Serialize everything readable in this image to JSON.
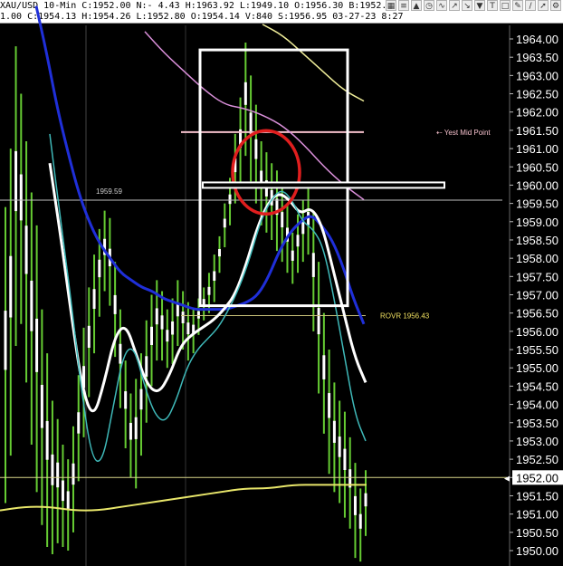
{
  "header": {
    "title_line": "XAU/USD 10-Min C:1952.00 N:- 4.43 H:1963.92 L:1949.10 O:1956.30 B:1952.",
    "info_line": "1.00 C:1954.13 H:1954.26 L:1952.80 O:1954.14 V:840 S:1956.95 03-27-23 8:27"
  },
  "toolbar": {
    "icons": [
      "grid-icon",
      "stack-icon",
      "pyramid-icon",
      "clock-icon",
      "wave-icon",
      "arrow-icon",
      "arrow-icon",
      "down-icon",
      "text-icon",
      "box-icon",
      "pencil-icon",
      "line-icon",
      "cursor-icon",
      "gear-icon"
    ]
  },
  "colors": {
    "background": "#000000",
    "price_labels": "#ffffff",
    "candles": "#ffffff",
    "candle_wick": "#66cc33",
    "ma_blue": "#1f2fd8",
    "ma_white": "#ffffff",
    "ma_teal": "#3fb9b9",
    "ma_pink": "#d98fd9",
    "ma_yellow": "#f0ee9a",
    "line_yellow": "#e8e66a",
    "pink_level": "#f5c0cc",
    "annotation_white": "#ffffff",
    "annotation_red": "#e01e1e",
    "rovr_text": "#f0e060",
    "yest_text": "#f5c0cc",
    "price_box": "#ffffff"
  },
  "chart_data": {
    "type": "candlestick",
    "symbol": "XAU/USD",
    "interval": "10-Min",
    "ylim": [
      1949.8,
      1964.3
    ],
    "y_ticks": [
      "1964.00",
      "1963.50",
      "1963.00",
      "1962.50",
      "1962.00",
      "1961.50",
      "1961.00",
      "1960.50",
      "1960.00",
      "1959.50",
      "1959.00",
      "1958.50",
      "1958.00",
      "1957.50",
      "1957.00",
      "1956.50",
      "1956.00",
      "1955.50",
      "1955.00",
      "1954.50",
      "1954.00",
      "1953.50",
      "1953.00",
      "1952.50",
      "1952.00",
      "1951.50",
      "1951.00",
      "1950.50",
      "1950.00"
    ],
    "current_price": "1952.00",
    "levels": [
      {
        "label": "Yest Mid Point",
        "value": 1961.45
      },
      {
        "label": "ROVR 1956.43",
        "value": 1956.43
      },
      {
        "label": "1959.59",
        "value": 1959.59
      },
      {
        "label": "",
        "value": 1960.0
      },
      {
        "label": "",
        "value": 1952.0
      }
    ],
    "bars_high": [
      1959.4,
      1961.0,
      1963.8,
      1962.5,
      1961.2,
      1959.8,
      1958.9,
      1956.6,
      1955.4,
      1954.1,
      1953.6,
      1952.9,
      1952.5,
      1953.4,
      1954.8,
      1956.1,
      1957.2,
      1958.1,
      1958.8,
      1959.3,
      1959.1,
      1957.9,
      1956.6,
      1955.2,
      1954.3,
      1954.7,
      1955.4,
      1956.3,
      1957.0,
      1957.4,
      1957.1,
      1956.6,
      1956.9,
      1957.4,
      1957.1,
      1956.8,
      1956.6,
      1956.9,
      1957.2,
      1957.6,
      1958.1,
      1958.6,
      1959.5,
      1960.2,
      1961.4,
      1962.4,
      1963.9,
      1963.0,
      1962.2,
      1961.2,
      1960.9,
      1960.6,
      1960.4,
      1960.0,
      1959.5,
      1958.7,
      1959.2,
      1959.6,
      1959.9,
      1959.3,
      1957.9,
      1956.5,
      1955.5,
      1954.6,
      1954.1,
      1953.8,
      1953.1,
      1952.4,
      1951.7,
      1952.2
    ],
    "bars_low": [
      1951.3,
      1952.6,
      1955.6,
      1956.2,
      1954.6,
      1952.9,
      1951.6,
      1950.7,
      1950.1,
      1949.9,
      1950.2,
      1950.1,
      1950.0,
      1950.5,
      1951.9,
      1953.1,
      1954.2,
      1955.4,
      1956.4,
      1957.1,
      1956.7,
      1955.3,
      1953.9,
      1952.8,
      1952.0,
      1951.7,
      1952.6,
      1953.5,
      1954.5,
      1955.2,
      1955.2,
      1955.0,
      1955.1,
      1955.6,
      1955.5,
      1955.2,
      1955.4,
      1955.9,
      1956.3,
      1956.5,
      1956.8,
      1957.6,
      1958.3,
      1958.9,
      1959.5,
      1959.9,
      1960.8,
      1960.1,
      1959.5,
      1958.9,
      1958.7,
      1958.5,
      1958.2,
      1957.9,
      1957.6,
      1957.3,
      1957.6,
      1957.9,
      1958.1,
      1956.0,
      1954.3,
      1953.2,
      1952.1,
      1951.6,
      1951.3,
      1950.9,
      1950.6,
      1949.8,
      1949.7,
      1950.4
    ],
    "series": [
      {
        "name": "",
        "color": "#1f2fd8",
        "values": [
          1964.9,
          1963.6,
          1962.1,
          1960.9,
          1959.8,
          1959.0,
          1958.4,
          1958.0,
          1957.6,
          1957.4,
          1957.2,
          1957.1,
          1956.9,
          1956.8,
          1956.7,
          1956.6,
          1956.6,
          1956.6,
          1956.6,
          1956.7,
          1956.8,
          1957.0,
          1957.5,
          1958.2,
          1958.7,
          1959.0,
          1959.2,
          1958.9,
          1958.5,
          1957.8,
          1956.9,
          1956.2
        ]
      },
      {
        "name": "",
        "color": "#ffffff",
        "values": [
          1960.6,
          1958.6,
          1956.4,
          1954.4,
          1953.6,
          1954.6,
          1955.9,
          1956.2,
          1955.3,
          1954.5,
          1954.3,
          1954.8,
          1955.6,
          1955.9,
          1956.1,
          1956.3,
          1956.6,
          1957.0,
          1957.8,
          1958.8,
          1959.5,
          1959.8,
          1959.6,
          1959.2,
          1959.4,
          1958.9,
          1957.7,
          1956.5,
          1955.3,
          1954.6
        ]
      },
      {
        "name": "",
        "color": "#3fb9b9",
        "values": [
          1961.4,
          1959.1,
          1956.9,
          1954.4,
          1952.5,
          1952.4,
          1953.9,
          1955.4,
          1955.6,
          1954.5,
          1953.7,
          1953.5,
          1954.1,
          1955.0,
          1955.5,
          1955.8,
          1956.1,
          1956.6,
          1957.2,
          1958.0,
          1959.0,
          1959.6,
          1959.9,
          1959.6,
          1959.0,
          1958.8,
          1958.3,
          1956.9,
          1955.3,
          1953.7,
          1953.0
        ]
      },
      {
        "name": "",
        "color": "#d98fd9",
        "values": [
          1964.2,
          1963.6,
          1963.1,
          1962.6,
          1962.2,
          1962.1,
          1961.9,
          1961.6,
          1961.1,
          1960.5,
          1960.0,
          1959.6
        ]
      },
      {
        "name": "",
        "color": "#f0ee9a",
        "values": [
          1964.4,
          1964.1,
          1963.6,
          1963.1,
          1962.6,
          1962.3
        ]
      },
      {
        "name": "",
        "color": "#e8e66a",
        "values": [
          1951.1,
          1951.2,
          1951.2,
          1951.1,
          1951.1,
          1951.2,
          1951.3,
          1951.4,
          1951.5,
          1951.6,
          1951.7,
          1951.7,
          1951.8,
          1951.8,
          1951.8,
          1951.8
        ]
      }
    ],
    "annotations": [
      {
        "shape": "rectangle",
        "color": "white",
        "x_bars": [
          36,
          61
        ],
        "y": [
          1956.7,
          1963.7
        ]
      },
      {
        "shape": "ellipse",
        "color": "red",
        "x_bars": [
          42,
          53
        ],
        "y": [
          1959.6,
          1961.2
        ]
      },
      {
        "shape": "bar-line",
        "color": "white",
        "x_bars": [
          36,
          77
        ],
        "y": [
          1960.0
        ]
      }
    ]
  }
}
